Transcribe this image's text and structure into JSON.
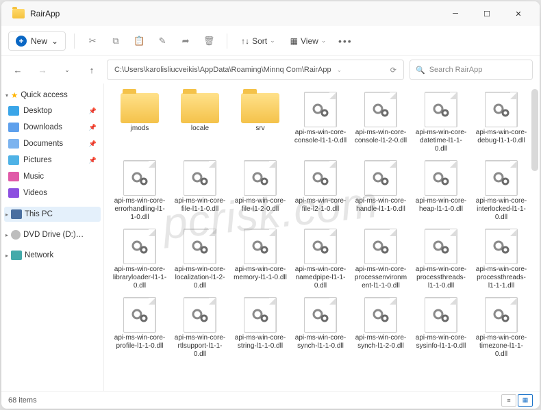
{
  "window": {
    "title": "RairApp"
  },
  "toolbar": {
    "new_label": "New",
    "sort_label": "Sort",
    "view_label": "View"
  },
  "nav": {
    "path": "C:\\Users\\karolisliucveikis\\AppData\\Roaming\\Minnq Com\\RairApp",
    "search_placeholder": "Search RairApp"
  },
  "sidebar": {
    "quick_access": "Quick access",
    "items": [
      {
        "label": "Desktop"
      },
      {
        "label": "Downloads"
      },
      {
        "label": "Documents"
      },
      {
        "label": "Pictures"
      },
      {
        "label": "Music"
      },
      {
        "label": "Videos"
      }
    ],
    "this_pc": "This PC",
    "dvd": "DVD Drive (D:) CCCC",
    "network": "Network"
  },
  "files": [
    {
      "name": "jmods",
      "type": "folder"
    },
    {
      "name": "locale",
      "type": "folder"
    },
    {
      "name": "srv",
      "type": "folder"
    },
    {
      "name": "api-ms-win-core-console-l1-1-0.dll",
      "type": "dll"
    },
    {
      "name": "api-ms-win-core-console-l1-2-0.dll",
      "type": "dll"
    },
    {
      "name": "api-ms-win-core-datetime-l1-1-0.dll",
      "type": "dll"
    },
    {
      "name": "api-ms-win-core-debug-l1-1-0.dll",
      "type": "dll"
    },
    {
      "name": "api-ms-win-core-errorhandling-l1-1-0.dll",
      "type": "dll"
    },
    {
      "name": "api-ms-win-core-file-l1-1-0.dll",
      "type": "dll"
    },
    {
      "name": "api-ms-win-core-file-l1-2-0.dll",
      "type": "dll"
    },
    {
      "name": "api-ms-win-core-file-l2-1-0.dll",
      "type": "dll"
    },
    {
      "name": "api-ms-win-core-handle-l1-1-0.dll",
      "type": "dll"
    },
    {
      "name": "api-ms-win-core-heap-l1-1-0.dll",
      "type": "dll"
    },
    {
      "name": "api-ms-win-core-interlocked-l1-1-0.dll",
      "type": "dll"
    },
    {
      "name": "api-ms-win-core-libraryloader-l1-1-0.dll",
      "type": "dll"
    },
    {
      "name": "api-ms-win-core-localization-l1-2-0.dll",
      "type": "dll"
    },
    {
      "name": "api-ms-win-core-memory-l1-1-0.dll",
      "type": "dll"
    },
    {
      "name": "api-ms-win-core-namedpipe-l1-1-0.dll",
      "type": "dll"
    },
    {
      "name": "api-ms-win-core-processenvironment-l1-1-0.dll",
      "type": "dll"
    },
    {
      "name": "api-ms-win-core-processthreads-l1-1-0.dll",
      "type": "dll"
    },
    {
      "name": "api-ms-win-core-processthreads-l1-1-1.dll",
      "type": "dll"
    },
    {
      "name": "api-ms-win-core-profile-l1-1-0.dll",
      "type": "dll"
    },
    {
      "name": "api-ms-win-core-rtlsupport-l1-1-0.dll",
      "type": "dll"
    },
    {
      "name": "api-ms-win-core-string-l1-1-0.dll",
      "type": "dll"
    },
    {
      "name": "api-ms-win-core-synch-l1-1-0.dll",
      "type": "dll"
    },
    {
      "name": "api-ms-win-core-synch-l1-2-0.dll",
      "type": "dll"
    },
    {
      "name": "api-ms-win-core-sysinfo-l1-1-0.dll",
      "type": "dll"
    },
    {
      "name": "api-ms-win-core-timezone-l1-1-0.dll",
      "type": "dll"
    }
  ],
  "status": {
    "count": "68 items"
  },
  "watermark": "pcrisk.com"
}
